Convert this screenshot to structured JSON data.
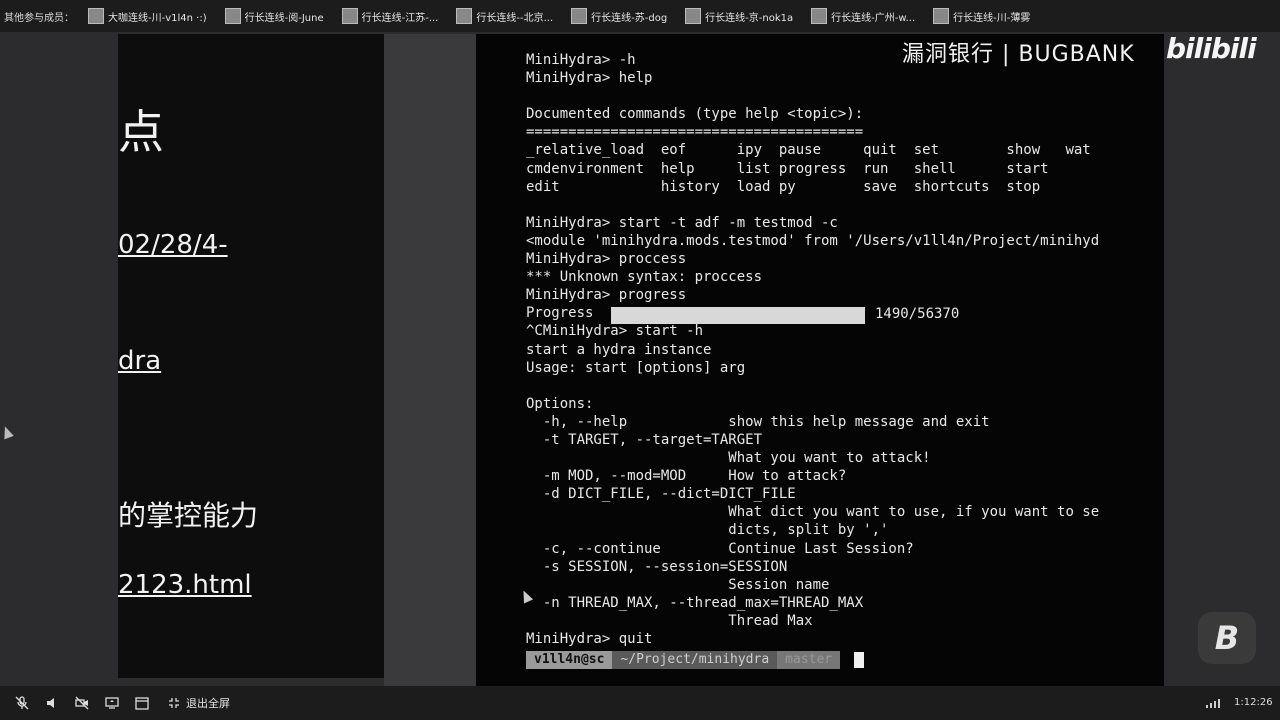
{
  "topbar": {
    "members_label": "其他参与成员：",
    "participants": [
      {
        "name": "大咖连线-川-v1l4n ·:)"
      },
      {
        "name": "行长连线-阅-June"
      },
      {
        "name": "行长连线-江苏-..."
      },
      {
        "name": "行长连线--北京..."
      },
      {
        "name": "行长连线-苏-dog"
      },
      {
        "name": "行长连线-京-nok1a"
      },
      {
        "name": "行长连线-广州-w..."
      },
      {
        "name": "行长连线-川-薄雾"
      }
    ]
  },
  "slide": {
    "heading": "点",
    "date_link": "02/28/4-",
    "hydra_link": "dra",
    "control_text": "的掌控能力",
    "html_link": "2123.html"
  },
  "watermark": {
    "bugbank": "漏洞银行 | BUGBANK",
    "bilibili": "bilibili",
    "badge": "B"
  },
  "terminal": {
    "lines": [
      "MiniHydra> -h",
      "MiniHydra> help",
      "",
      "Documented commands (type help <topic>):",
      "========================================",
      "_relative_load  eof      ipy  pause     quit  set        show   wat",
      "cmdenvironment  help     list progress  run   shell      start",
      "edit            history  load py        save  shortcuts  stop",
      "",
      "MiniHydra> start -t adf -m testmod -c",
      "<module 'minihydra.mods.testmod' from '/Users/v1ll4n/Project/minihyd",
      "MiniHydra> proccess",
      "*** Unknown syntax: proccess",
      "MiniHydra> progress",
      "Progress",
      "^CMiniHydra> start -h",
      "start a hydra instance",
      "Usage: start [options] arg",
      "",
      "Options:",
      "  -h, --help            show this help message and exit",
      "  -t TARGET, --target=TARGET",
      "                        What you want to attack!",
      "  -m MOD, --mod=MOD     How to attack?",
      "  -d DICT_FILE, --dict=DICT_FILE",
      "                        What dict you want to use, if you want to se",
      "                        dicts, split by ','",
      "  -c, --continue        Continue Last Session?",
      "  -s SESSION, --session=SESSION",
      "                        Session name",
      "  -n THREAD_MAX, --thread_max=THREAD_MAX",
      "                        Thread Max",
      "MiniHydra> quit"
    ],
    "progress_count": "1490/56370",
    "progress_fraction": 0.026,
    "prompt": {
      "user": "v1ll4n@sc",
      "path": "~/Project/minihydra",
      "git": "master"
    }
  },
  "bottombar": {
    "exit_fullscreen": "退出全屏",
    "clock": "1:12:26"
  }
}
